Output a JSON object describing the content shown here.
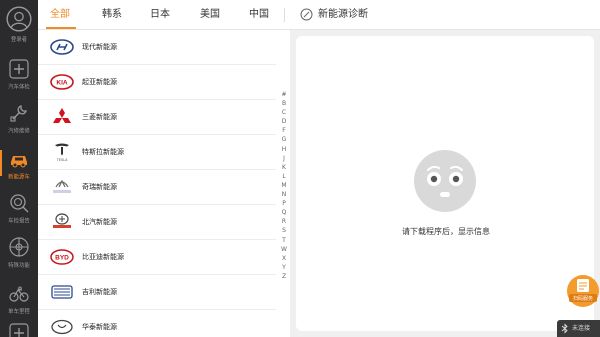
{
  "sidebar": {
    "items": [
      {
        "label": "登录者",
        "icon": "avatar-icon",
        "active": false
      },
      {
        "label": "汽车体检",
        "icon": "car-health-icon",
        "active": false
      },
      {
        "label": "汽修维修",
        "icon": "repair-icon",
        "active": false
      },
      {
        "label": "新能源车",
        "icon": "ev-car-icon",
        "active": true
      },
      {
        "label": "车检报告",
        "icon": "search-report-icon",
        "active": false
      },
      {
        "label": "特殊功能",
        "icon": "special-function-icon",
        "active": false
      },
      {
        "label": "单车里程",
        "icon": "bike-icon",
        "active": false
      },
      {
        "label": "",
        "icon": "plus-icon",
        "active": false
      }
    ]
  },
  "tabs": [
    {
      "label": "全部",
      "active": true
    },
    {
      "label": "韩系",
      "active": false
    },
    {
      "label": "日本",
      "active": false
    },
    {
      "label": "美国",
      "active": false
    },
    {
      "label": "中国",
      "active": false
    }
  ],
  "diagnosis_tab": {
    "label": "新能源诊断",
    "icon": "diagnosis-icon"
  },
  "brands": [
    {
      "name": "现代新能源",
      "logo": "hyundai-logo"
    },
    {
      "name": "起亚新能源",
      "logo": "kia-logo"
    },
    {
      "name": "三菱新能源",
      "logo": "mitsubishi-logo"
    },
    {
      "name": "特斯拉新能源",
      "logo": "tesla-logo",
      "logo_text": "TESLA"
    },
    {
      "name": "奇瑞新能源",
      "logo": "chery-logo"
    },
    {
      "name": "北汽新能源",
      "logo": "baic-logo"
    },
    {
      "name": "比亚迪新能源",
      "logo": "byd-logo",
      "logo_text": "BYD"
    },
    {
      "name": "吉利新能源",
      "logo": "geely-logo"
    },
    {
      "name": "华泰新能源",
      "logo": "hawtai-logo"
    }
  ],
  "alphabet": [
    "#",
    "B",
    "C",
    "D",
    "F",
    "G",
    "H",
    "J",
    "K",
    "L",
    "M",
    "N",
    "P",
    "Q",
    "R",
    "S",
    "T",
    "W",
    "X",
    "Y",
    "Z"
  ],
  "empty_state": {
    "icon": "surprised-face-icon",
    "message": "请下载程序后，显示信息"
  },
  "floating_badge": {
    "label": "扫码服务",
    "icon": "report-badge-icon"
  },
  "bluetooth": {
    "label": "未连接",
    "icon": "bluetooth-icon"
  },
  "colors": {
    "accent": "#f08a24",
    "sidebar": "#2b2b2d",
    "panel_bg": "#f0f0f0"
  }
}
